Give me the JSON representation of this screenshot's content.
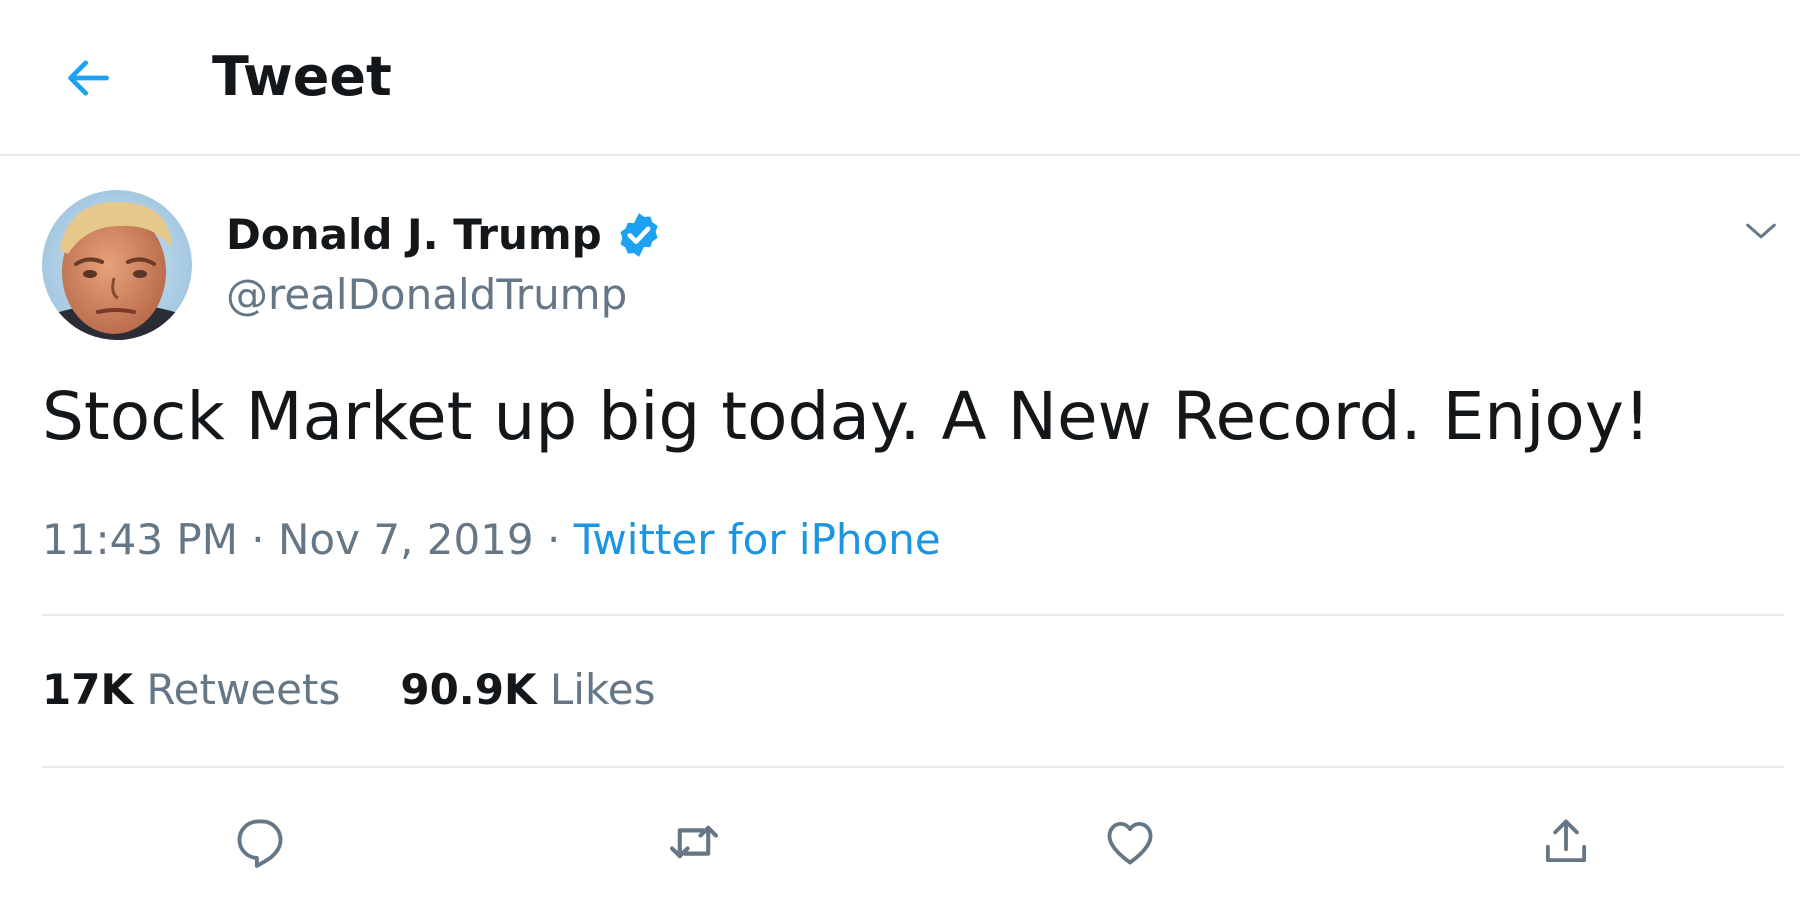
{
  "header": {
    "back_icon": "arrow-left-icon",
    "title": "Tweet"
  },
  "tweet": {
    "author": {
      "display_name": "Donald J. Trump",
      "handle": "@realDonaldTrump",
      "verified": true
    },
    "text": "Stock Market up big today. A New Record. Enjoy!",
    "time": "11:43 PM",
    "date": "Nov 7, 2019",
    "separator": " · ",
    "source": "Twitter for iPhone",
    "stats": {
      "retweets_count": "17K",
      "retweets_label": "Retweets",
      "likes_count": "90.9K",
      "likes_label": "Likes"
    },
    "actions": [
      "reply-icon",
      "retweet-icon",
      "like-icon",
      "share-icon"
    ]
  },
  "colors": {
    "accent": "#1b95e0",
    "verified": "#1da1f2",
    "primary_text": "#14171a",
    "secondary_text": "#657786",
    "border": "#e6ecf0"
  }
}
